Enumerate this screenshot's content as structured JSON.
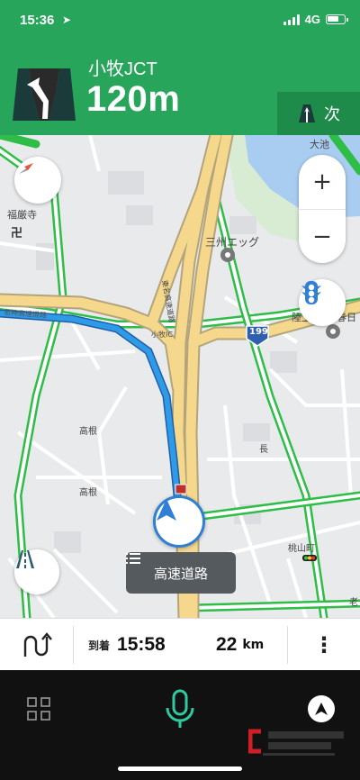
{
  "status_bar": {
    "time": "15:36",
    "network": "4G"
  },
  "guidance": {
    "junction_name": "小牧JCT",
    "distance": "120m",
    "next_label": "次"
  },
  "map": {
    "labels": {
      "temple": "福厳寺",
      "manji": "卍",
      "factory": "三州エッグ",
      "route_shield": "199",
      "lake": "大池",
      "rikujo": "陸上",
      "kasugai": "春日",
      "takane1": "高根",
      "takane2": "高根",
      "momoyama": "桃山町",
      "road1": "東名高速道路",
      "road2": "名神高速道路",
      "komaki_ic": "小牧IC",
      "hase": "長",
      "ro": "老"
    },
    "zoom_in": "+",
    "zoom_out": "−",
    "highway_pill": "高速道路"
  },
  "info_bar": {
    "arrival_label": "到着",
    "arrival_time": "15:58",
    "distance_value": "22",
    "distance_unit": "km",
    "more": "⋮"
  },
  "colors": {
    "brand_green": "#27a55b",
    "route_blue": "#2f7fd6",
    "highway_fill": "#f6d88d",
    "mic_teal": "#2fc9a0"
  }
}
